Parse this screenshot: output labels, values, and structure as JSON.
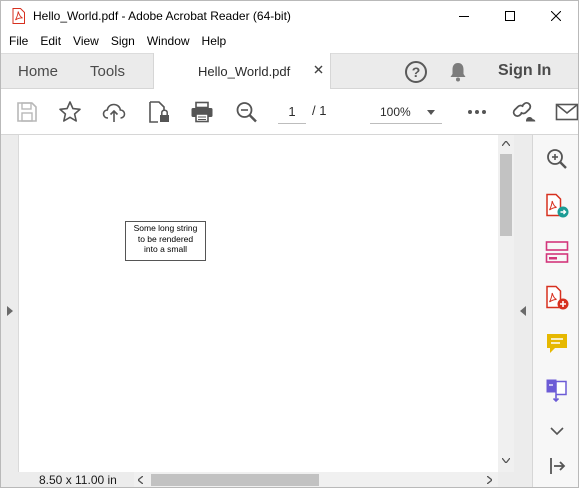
{
  "window": {
    "title": "Hello_World.pdf - Adobe Acrobat Reader (64-bit)"
  },
  "menu": [
    "File",
    "Edit",
    "View",
    "Sign",
    "Window",
    "Help"
  ],
  "tabs": {
    "home": "Home",
    "tools": "Tools",
    "document": "Hello_World.pdf",
    "sign_in": "Sign In"
  },
  "toolbar": {
    "current_page": "1",
    "page_total": "/  1",
    "zoom": "100%"
  },
  "document": {
    "text_lines": [
      "Some long string",
      "to be rendered",
      "into a small"
    ]
  },
  "status": {
    "page_size": "8.50 x 11.00 in"
  },
  "icons": {
    "app": "pdf-file-icon",
    "save": "save-icon",
    "bookmark": "star-icon",
    "upload": "cloud-upload-icon",
    "protect": "lock-file-icon",
    "print": "printer-icon",
    "find": "magnifier-icon",
    "more": "more-icon",
    "share_link": "link-icon",
    "email": "mail-icon",
    "right_panel": [
      "zoom-in-icon",
      "export-pdf-icon",
      "organize-pages-icon",
      "create-pdf-icon",
      "comment-icon",
      "combine-files-icon",
      "chevron-down-icon",
      "sidebar-collapse-icon"
    ]
  },
  "colors": {
    "acrobat_red": "#d7301f",
    "export_teal": "#1b9c95",
    "organize_pink": "#d3367b",
    "comment_yellow": "#e6b800",
    "combine_purple": "#6c5bd6"
  }
}
